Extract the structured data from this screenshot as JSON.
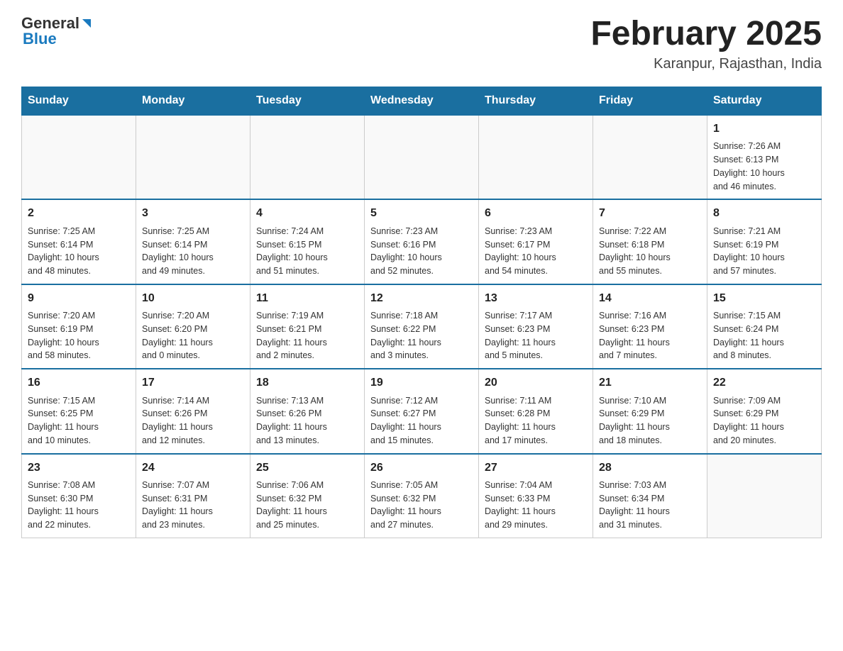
{
  "header": {
    "month_year": "February 2025",
    "location": "Karanpur, Rajasthan, India",
    "logo_general": "General",
    "logo_blue": "Blue"
  },
  "weekdays": [
    "Sunday",
    "Monday",
    "Tuesday",
    "Wednesday",
    "Thursday",
    "Friday",
    "Saturday"
  ],
  "weeks": [
    [
      {
        "day": "",
        "info": ""
      },
      {
        "day": "",
        "info": ""
      },
      {
        "day": "",
        "info": ""
      },
      {
        "day": "",
        "info": ""
      },
      {
        "day": "",
        "info": ""
      },
      {
        "day": "",
        "info": ""
      },
      {
        "day": "1",
        "info": "Sunrise: 7:26 AM\nSunset: 6:13 PM\nDaylight: 10 hours\nand 46 minutes."
      }
    ],
    [
      {
        "day": "2",
        "info": "Sunrise: 7:25 AM\nSunset: 6:14 PM\nDaylight: 10 hours\nand 48 minutes."
      },
      {
        "day": "3",
        "info": "Sunrise: 7:25 AM\nSunset: 6:14 PM\nDaylight: 10 hours\nand 49 minutes."
      },
      {
        "day": "4",
        "info": "Sunrise: 7:24 AM\nSunset: 6:15 PM\nDaylight: 10 hours\nand 51 minutes."
      },
      {
        "day": "5",
        "info": "Sunrise: 7:23 AM\nSunset: 6:16 PM\nDaylight: 10 hours\nand 52 minutes."
      },
      {
        "day": "6",
        "info": "Sunrise: 7:23 AM\nSunset: 6:17 PM\nDaylight: 10 hours\nand 54 minutes."
      },
      {
        "day": "7",
        "info": "Sunrise: 7:22 AM\nSunset: 6:18 PM\nDaylight: 10 hours\nand 55 minutes."
      },
      {
        "day": "8",
        "info": "Sunrise: 7:21 AM\nSunset: 6:19 PM\nDaylight: 10 hours\nand 57 minutes."
      }
    ],
    [
      {
        "day": "9",
        "info": "Sunrise: 7:20 AM\nSunset: 6:19 PM\nDaylight: 10 hours\nand 58 minutes."
      },
      {
        "day": "10",
        "info": "Sunrise: 7:20 AM\nSunset: 6:20 PM\nDaylight: 11 hours\nand 0 minutes."
      },
      {
        "day": "11",
        "info": "Sunrise: 7:19 AM\nSunset: 6:21 PM\nDaylight: 11 hours\nand 2 minutes."
      },
      {
        "day": "12",
        "info": "Sunrise: 7:18 AM\nSunset: 6:22 PM\nDaylight: 11 hours\nand 3 minutes."
      },
      {
        "day": "13",
        "info": "Sunrise: 7:17 AM\nSunset: 6:23 PM\nDaylight: 11 hours\nand 5 minutes."
      },
      {
        "day": "14",
        "info": "Sunrise: 7:16 AM\nSunset: 6:23 PM\nDaylight: 11 hours\nand 7 minutes."
      },
      {
        "day": "15",
        "info": "Sunrise: 7:15 AM\nSunset: 6:24 PM\nDaylight: 11 hours\nand 8 minutes."
      }
    ],
    [
      {
        "day": "16",
        "info": "Sunrise: 7:15 AM\nSunset: 6:25 PM\nDaylight: 11 hours\nand 10 minutes."
      },
      {
        "day": "17",
        "info": "Sunrise: 7:14 AM\nSunset: 6:26 PM\nDaylight: 11 hours\nand 12 minutes."
      },
      {
        "day": "18",
        "info": "Sunrise: 7:13 AM\nSunset: 6:26 PM\nDaylight: 11 hours\nand 13 minutes."
      },
      {
        "day": "19",
        "info": "Sunrise: 7:12 AM\nSunset: 6:27 PM\nDaylight: 11 hours\nand 15 minutes."
      },
      {
        "day": "20",
        "info": "Sunrise: 7:11 AM\nSunset: 6:28 PM\nDaylight: 11 hours\nand 17 minutes."
      },
      {
        "day": "21",
        "info": "Sunrise: 7:10 AM\nSunset: 6:29 PM\nDaylight: 11 hours\nand 18 minutes."
      },
      {
        "day": "22",
        "info": "Sunrise: 7:09 AM\nSunset: 6:29 PM\nDaylight: 11 hours\nand 20 minutes."
      }
    ],
    [
      {
        "day": "23",
        "info": "Sunrise: 7:08 AM\nSunset: 6:30 PM\nDaylight: 11 hours\nand 22 minutes."
      },
      {
        "day": "24",
        "info": "Sunrise: 7:07 AM\nSunset: 6:31 PM\nDaylight: 11 hours\nand 23 minutes."
      },
      {
        "day": "25",
        "info": "Sunrise: 7:06 AM\nSunset: 6:32 PM\nDaylight: 11 hours\nand 25 minutes."
      },
      {
        "day": "26",
        "info": "Sunrise: 7:05 AM\nSunset: 6:32 PM\nDaylight: 11 hours\nand 27 minutes."
      },
      {
        "day": "27",
        "info": "Sunrise: 7:04 AM\nSunset: 6:33 PM\nDaylight: 11 hours\nand 29 minutes."
      },
      {
        "day": "28",
        "info": "Sunrise: 7:03 AM\nSunset: 6:34 PM\nDaylight: 11 hours\nand 31 minutes."
      },
      {
        "day": "",
        "info": ""
      }
    ]
  ]
}
